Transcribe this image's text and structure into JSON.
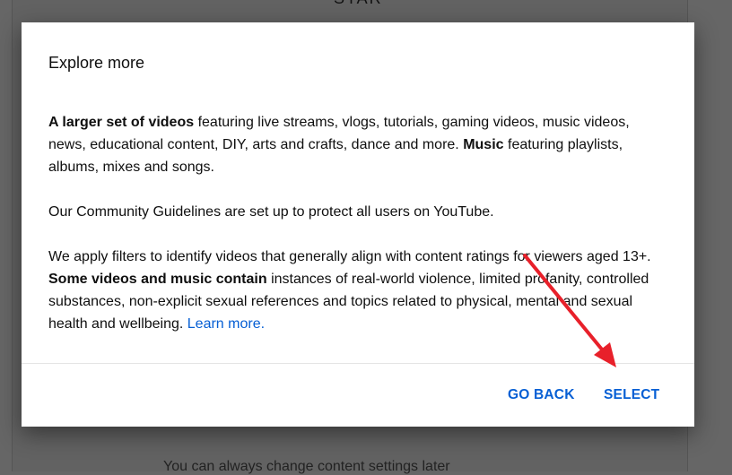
{
  "background": {
    "top_title": "STAR",
    "bottom_note": "You can always change content settings later"
  },
  "dialog": {
    "title": "Explore more",
    "para1": {
      "bold1": "A larger set of videos",
      "text1": " featuring live streams, vlogs, tutorials, gaming videos, music videos, news, educational content, DIY, arts and crafts, dance and more. ",
      "bold2": "Music",
      "text2": " featuring playlists, albums, mixes and songs."
    },
    "para2": "Our Community Guidelines are set up to protect all users on YouTube.",
    "para3": {
      "text1": "We apply filters to identify videos that generally align with content ratings for viewers aged 13+. ",
      "bold1": "Some videos and music contain",
      "text2": " instances of real-world violence, limited profanity, controlled substances, non-explicit sexual references and topics related to physical, mental and sexual health and wellbeing. ",
      "link": "Learn more."
    },
    "buttons": {
      "go_back": "GO BACK",
      "select": "SELECT"
    }
  },
  "annotation": {
    "arrow_color": "#e8202a"
  }
}
